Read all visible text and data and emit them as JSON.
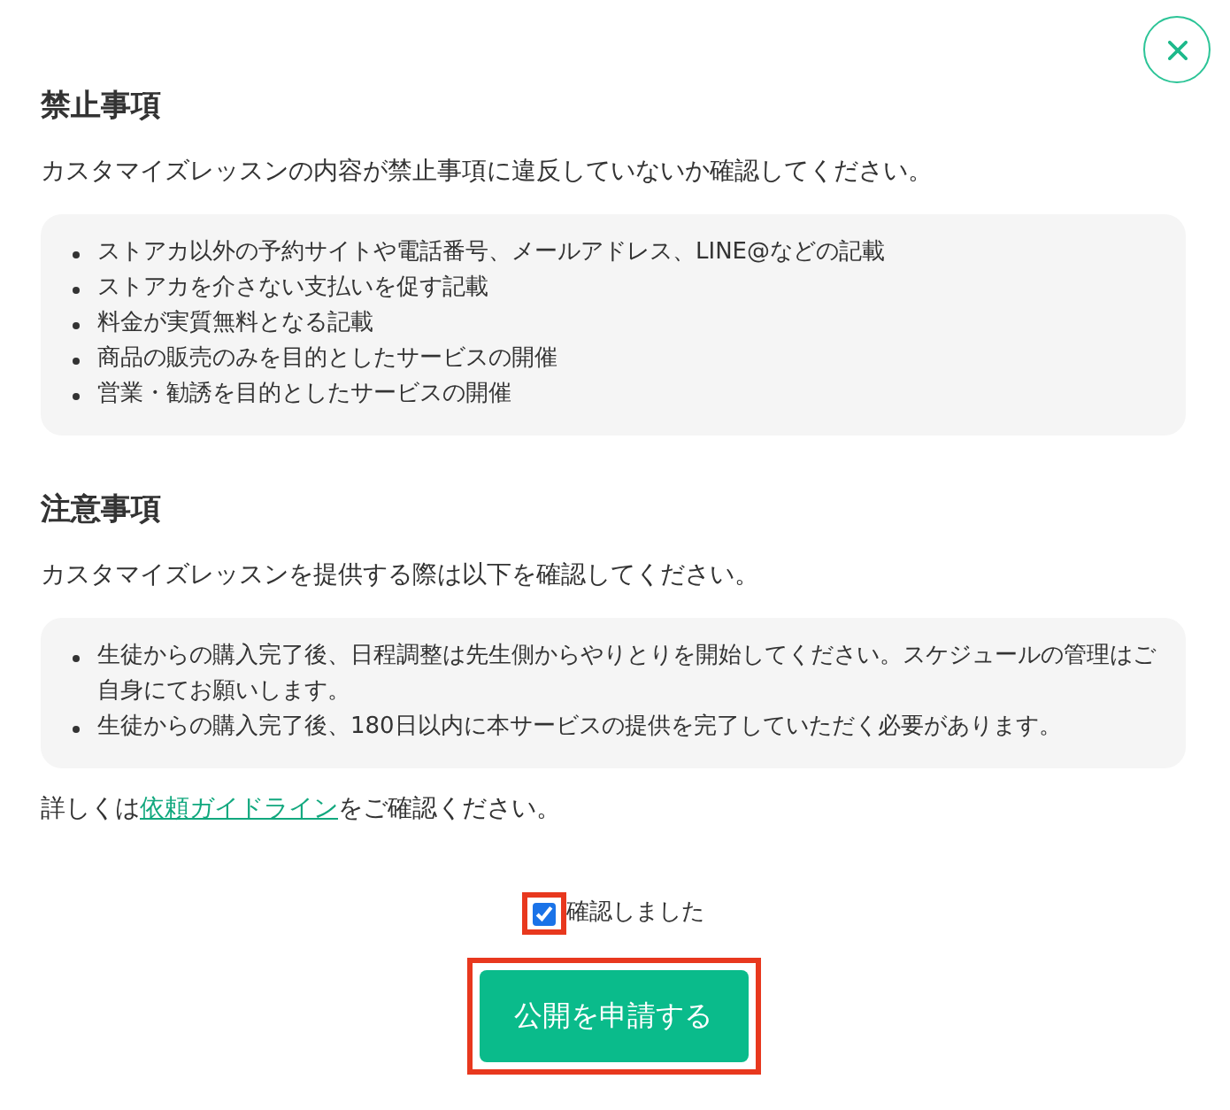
{
  "sections": [
    {
      "title": "禁止事項",
      "description": "カスタマイズレッスンの内容が禁止事項に違反していないか確認してください。",
      "items": [
        "ストアカ以外の予約サイトや電話番号、メールアドレス、LINE@などの記載",
        "ストアカを介さない支払いを促す記載",
        "料金が実質無料となる記載",
        "商品の販売のみを目的としたサービスの開催",
        "営業・勧誘を目的としたサービスの開催"
      ]
    },
    {
      "title": "注意事項",
      "description": "カスタマイズレッスンを提供する際は以下を確認してください。",
      "items": [
        "生徒からの購入完了後、日程調整は先生側からやりとりを開始してください。スケジュールの管理はご自身にてお願いします。",
        "生徒からの購入完了後、180日以内に本サービスの提供を完了していただく必要があります。"
      ]
    }
  ],
  "guideline_note": {
    "before": "詳しくは",
    "link": "依頼ガイドライン",
    "after": "をご確認ください。"
  },
  "confirm": {
    "label": "確認しました",
    "checked": true,
    "highlighted": true
  },
  "submit_button": {
    "label": "公開を申請する",
    "highlighted": true
  }
}
